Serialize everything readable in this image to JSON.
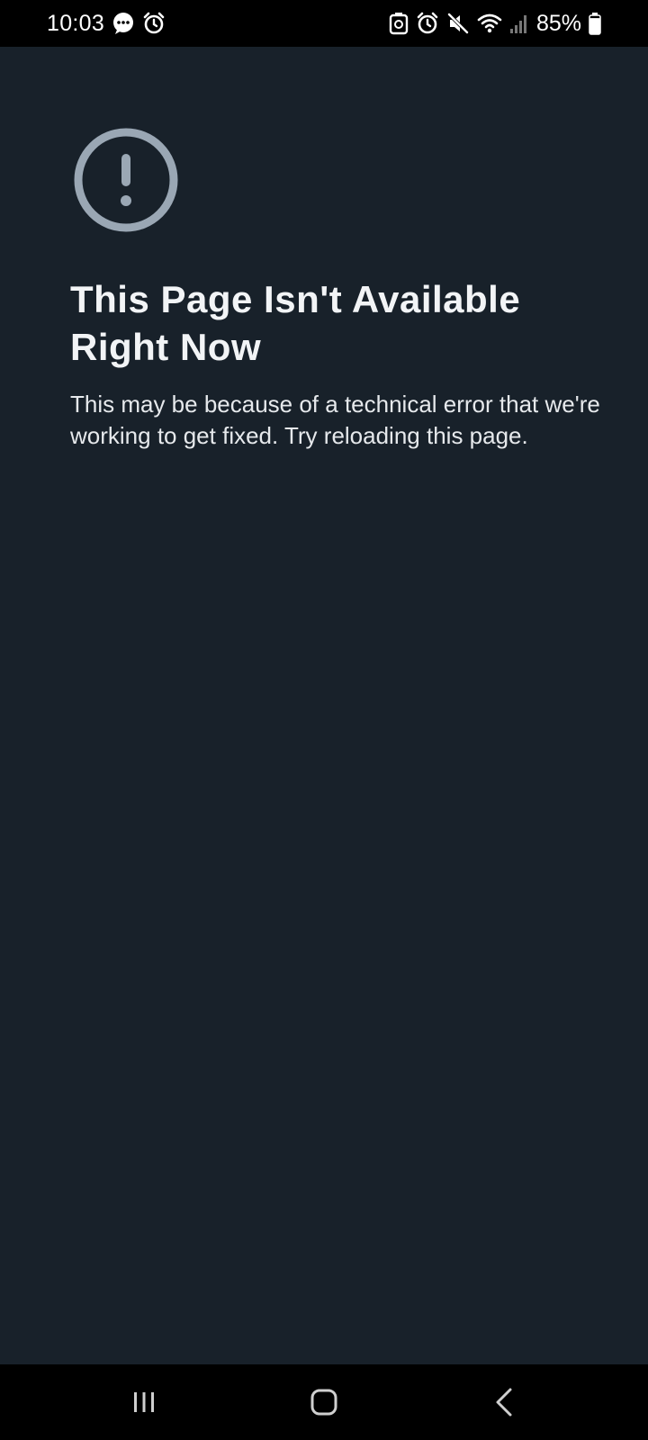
{
  "status_bar": {
    "time": "10:03",
    "battery_percent": "85%",
    "battery_level": 0.85,
    "left_icons": [
      "messenger-icon",
      "alarm-icon"
    ],
    "right_icons": [
      "data-saver-icon",
      "alarm-icon",
      "mute-icon",
      "wifi-icon",
      "signal-icon",
      "battery-icon"
    ]
  },
  "error_page": {
    "icon": "alert-circle-icon",
    "title": "This Page Isn't Available Right Now",
    "message": "This may be because of a technical error that we're working to get fixed. Try reloading this page."
  },
  "nav_bar": {
    "buttons": [
      "recent-apps-icon",
      "home-icon",
      "back-icon"
    ]
  },
  "colors": {
    "background": "#18212a",
    "icon": "#9aa7b4",
    "title": "#f2f4f6",
    "text": "#e6e9ec",
    "bars": "#000000"
  }
}
